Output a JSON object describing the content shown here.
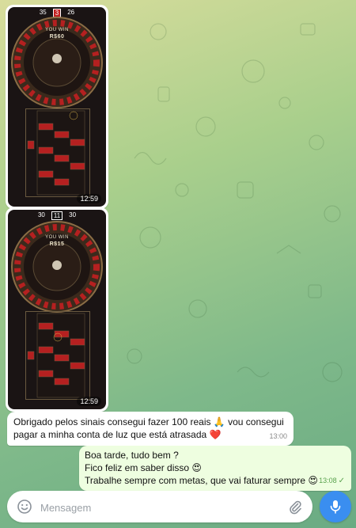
{
  "chat": {
    "photos": [
      {
        "time": "12:59",
        "top_numbers": [
          "35",
          "3",
          "26"
        ],
        "win_text": "YOU WIN",
        "win_amount": "R$60"
      },
      {
        "time": "12:59",
        "top_numbers": [
          "30",
          "11",
          "30"
        ],
        "win_text": "YOU WIN",
        "win_amount": "R$15"
      }
    ],
    "incoming": {
      "line1": "Obrigado pelos sinais consegui fazer 100 reais 🙏 vou consegui",
      "line2": "pagar a minha conta de luz que está atrasada ❤️",
      "time": "13:00"
    },
    "outgoing": {
      "line1": "Boa tarde, tudo bem ?",
      "line2": "Fico feliz em saber disso 😍",
      "line3": "Trabalhe sempre com metas, que vai faturar sempre 😍",
      "time": "13:08",
      "check": "✓"
    }
  },
  "composer": {
    "placeholder": "Mensagem"
  },
  "colors": {
    "outgoing_bubble": "#eefee0",
    "incoming_bubble": "#ffffff",
    "send_button": "#3a8ef0"
  }
}
